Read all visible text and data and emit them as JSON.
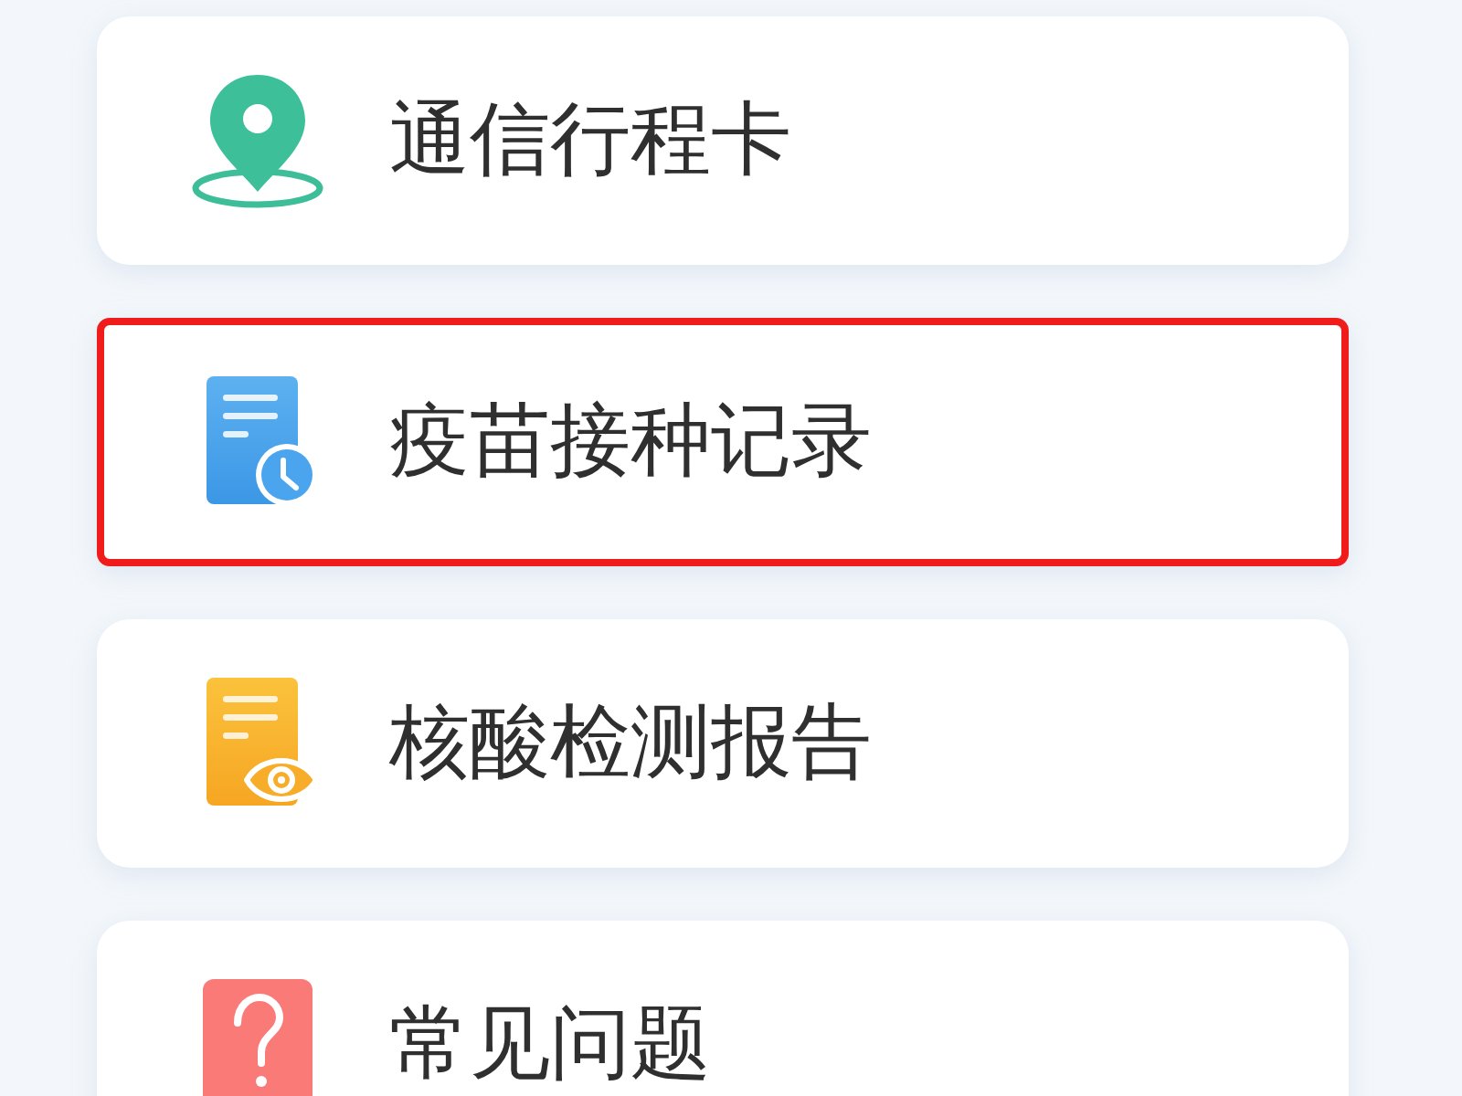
{
  "items": [
    {
      "kind": "location",
      "label": "通信行程卡",
      "highlighted": false
    },
    {
      "kind": "vaccine",
      "label": "疫苗接种记录",
      "highlighted": true
    },
    {
      "kind": "test",
      "label": "核酸检测报告",
      "highlighted": false
    },
    {
      "kind": "faq",
      "label": "常见问题",
      "highlighted": false
    }
  ]
}
